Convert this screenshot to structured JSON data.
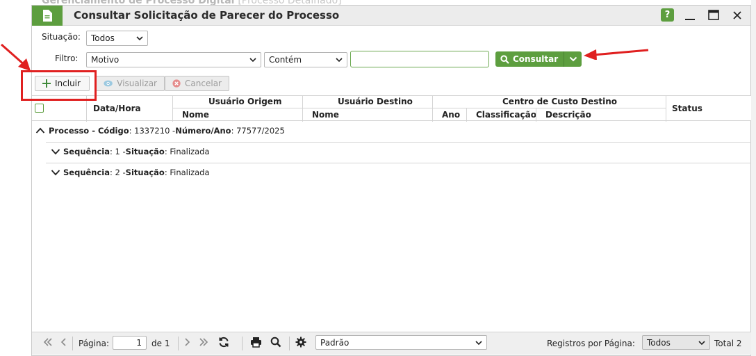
{
  "background": {
    "title": "Gerenciamento de Processo Digital",
    "subtitle": "[Processo Detalhado]"
  },
  "window": {
    "title": "Consultar Solicitação de Parecer do Processo",
    "icons": [
      "document-icon",
      "help-icon",
      "minimize-icon",
      "maximize-icon",
      "close-icon"
    ],
    "help_label": "?"
  },
  "filters": {
    "situacao_label": "Situação:",
    "situacao_value": "Todos",
    "filtro_label": "Filtro:",
    "filtro_field": "Motivo",
    "filtro_operator": "Contém",
    "filtro_text": "",
    "consultar_label": "Consultar"
  },
  "toolbar": {
    "incluir_label": "Incluir",
    "visualizar_label": "Visualizar",
    "cancelar_label": "Cancelar"
  },
  "grid": {
    "headers": {
      "data_hora": "Data/Hora",
      "usuario_origem": "Usuário Origem",
      "usuario_origem_nome": "Nome",
      "usuario_destino": "Usuário Destino",
      "usuario_destino_nome": "Nome",
      "centro_custo": "Centro de Custo Destino",
      "ano": "Ano",
      "classificacao": "Classificação",
      "descricao": "Descrição",
      "status": "Status"
    },
    "process_group": {
      "label_processo": "Processo - Código",
      "codigo": ": 1337210 - ",
      "label_numero": "Número/Ano",
      "numero": ": 77577/2025"
    },
    "sequences": [
      {
        "label_seq": "Sequência",
        "seq": ": 1 - ",
        "label_sit": "Situação",
        "sit": ": Finalizada"
      },
      {
        "label_seq": "Sequência",
        "seq": ": 2 - ",
        "label_sit": "Situação",
        "sit": ": Finalizada"
      }
    ]
  },
  "pagination": {
    "pagina_label": "Página:",
    "pagina_value": "1",
    "de_label": "de 1",
    "layout_value": "Padrão",
    "registros_label": "Registros por Página:",
    "registros_value": "Todos",
    "total_label": "Total 2"
  },
  "colors": {
    "accent": "#5d9e3f",
    "annotation": "#e02020"
  }
}
